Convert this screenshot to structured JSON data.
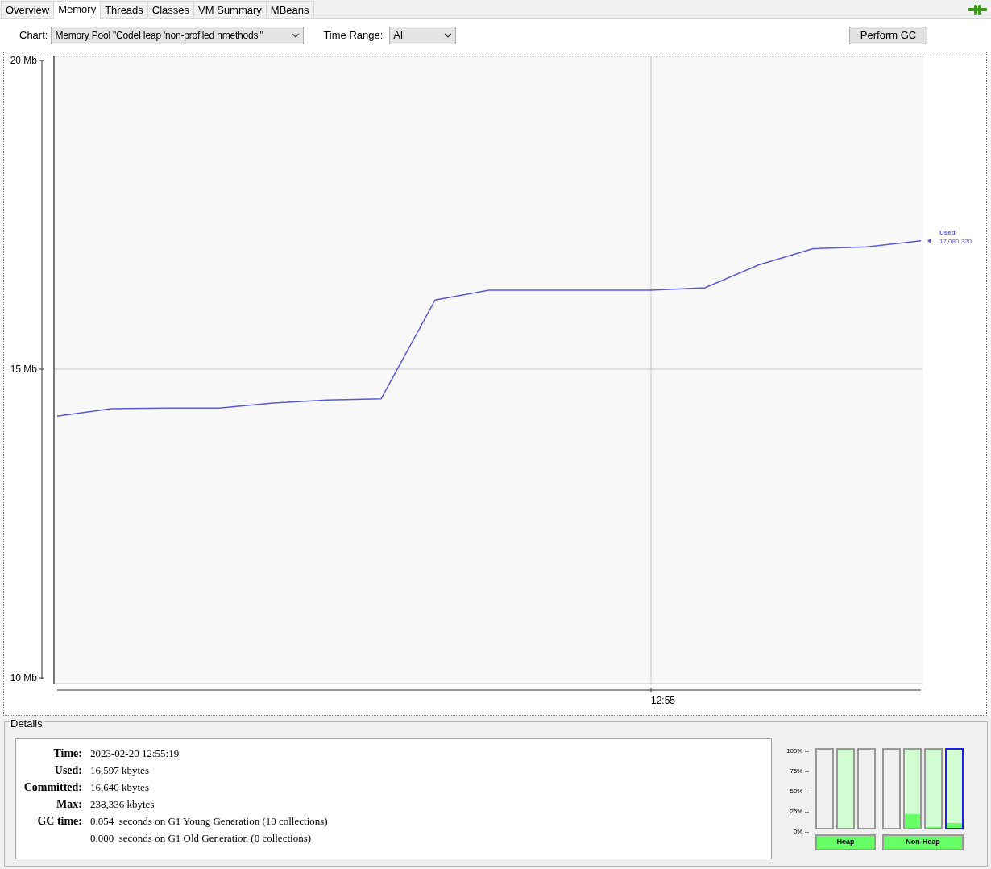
{
  "tabs": [
    {
      "label": "Overview",
      "selected": false
    },
    {
      "label": "Memory",
      "selected": true
    },
    {
      "label": "Threads",
      "selected": false
    },
    {
      "label": "Classes",
      "selected": false
    },
    {
      "label": "VM Summary",
      "selected": false
    },
    {
      "label": "MBeans",
      "selected": false
    }
  ],
  "connected": true,
  "toolbar": {
    "chart_label": "Chart:",
    "chart_value": "Memory Pool \"CodeHeap 'non-profiled nmethods'\"",
    "time_range_label": "Time Range:",
    "time_range_value": "All",
    "gc_button": "Perform GC"
  },
  "chart": {
    "chart_data": {
      "type": "line",
      "categories": [
        null,
        null,
        null,
        null,
        null,
        null,
        null,
        null,
        null,
        null,
        null,
        "12:55",
        null,
        null,
        null,
        null,
        null
      ],
      "ylim": [
        10,
        20
      ],
      "yticks": [
        {
          "value": 10,
          "label": "10 Mb"
        },
        {
          "value": 15,
          "label": "15 Mb"
        },
        {
          "value": 20,
          "label": "20 Mb"
        }
      ],
      "series": [
        {
          "name": "Used",
          "color": "#5a5ad8",
          "values": [
            14.24,
            14.36,
            14.37,
            14.37,
            14.45,
            14.5,
            14.52,
            16.12,
            16.28,
            16.28,
            16.28,
            16.28,
            16.32,
            16.69,
            16.95,
            16.98,
            17.08
          ]
        }
      ]
    },
    "value_label": {
      "value": "17,080,320"
    }
  },
  "details": {
    "title": "Details",
    "rows": [
      {
        "label": "Time:",
        "values": [
          "2023-02-20 12:55:19"
        ]
      },
      {
        "label": "Used:",
        "values": [
          "16,597 kbytes"
        ]
      },
      {
        "label": "Committed:",
        "values": [
          "16,640 kbytes"
        ]
      },
      {
        "label": "Max:",
        "values": [
          "238,336 kbytes"
        ]
      },
      {
        "label": "GC time:",
        "values": [
          "0.054  seconds on G1 Young Generation (10 collections)",
          "0.000  seconds on G1 Old Generation (0 collections)"
        ]
      }
    ]
  },
  "pools": {
    "scale": [
      "100% --",
      "75% --",
      "50% --",
      "25% --",
      "0% --"
    ],
    "groups": [
      {
        "label": "Heap",
        "bars": [
          {
            "committed": false,
            "selected": false
          },
          {
            "committed": true,
            "selected": false
          },
          {
            "committed": false,
            "selected": false
          }
        ]
      },
      {
        "label": "Non-Heap",
        "bars": [
          {
            "committed": false,
            "selected": false
          },
          {
            "committed": true,
            "level": 0.18,
            "selected": false
          },
          {
            "committed": true,
            "level": 0.01,
            "selected": false
          },
          {
            "committed": true,
            "level": 0.06,
            "selected": true
          }
        ]
      }
    ]
  }
}
